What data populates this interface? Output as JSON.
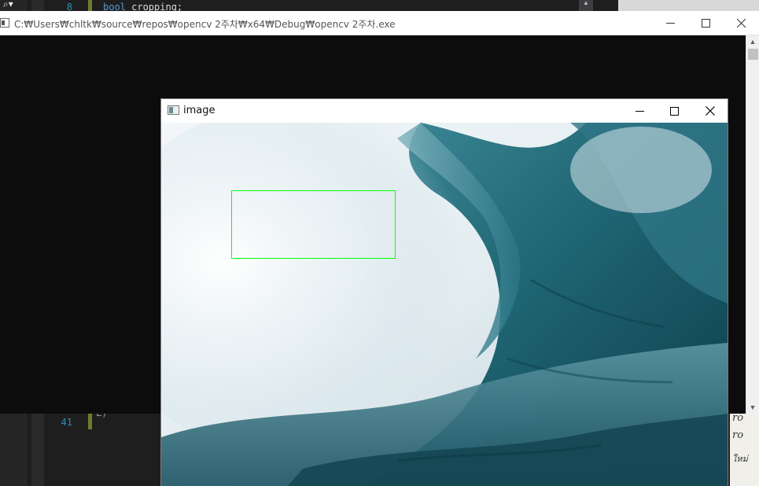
{
  "editor": {
    "lines": [
      {
        "num": "8",
        "tokens": [
          {
            "text": "bool",
            "kw": true
          },
          {
            "text": " cropping;",
            "kw": false
          }
        ]
      },
      {
        "num": "41",
        "tokens": [
          {
            "text": "",
            "kw": false
          }
        ]
      }
    ],
    "partial_line": "L)",
    "search_glyph": "⌕▾"
  },
  "right_document": {
    "snippets": [
      "ro",
      "ro",
      "ใหม่"
    ]
  },
  "console": {
    "title": "C:₩Users₩chltk₩source₩repos₩opencv 2주차₩x64₩Debug₩opencv 2주차.exe",
    "icon": "console-app-icon",
    "minimize_icon": "minimize-icon",
    "maximize_icon": "maximize-icon",
    "close_icon": "close-icon"
  },
  "image_window": {
    "title": "image",
    "icon": "image-window-icon",
    "minimize_icon": "minimize-icon",
    "maximize_icon": "maximize-icon",
    "close_icon": "close-icon",
    "image_subject": "ocean wave",
    "selection_color": "#00ff00"
  },
  "colors": {
    "console_bg": "#0c0c0c",
    "editor_bg": "#1e1e1e",
    "line_number": "#2b91af",
    "keyword": "#569cd6",
    "selection": "#00ff00"
  }
}
